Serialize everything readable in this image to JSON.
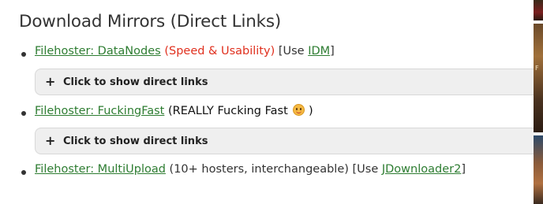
{
  "heading": "Download Mirrors (Direct Links)",
  "mirrors": [
    {
      "host_link": "Filehoster: DataNodes",
      "note": "(Speed & Usability)",
      "bracket_open": " [Use ",
      "tool_link": "IDM",
      "bracket_close": "]",
      "toggle_label": "Click to show direct links"
    },
    {
      "host_link": "Filehoster: FuckingFast",
      "note": " (REALLY Fucking Fast ",
      "emoji": "smiley-face-icon",
      "note_close": " )",
      "toggle_label": "Click to show direct links"
    },
    {
      "host_link": "Filehoster: MultiUpload",
      "note": " (10+ hosters, interchangeable) [Use ",
      "tool_link": "JDownloader2",
      "bracket_close": "]"
    }
  ],
  "colors": {
    "link": "#2e7d32",
    "highlight": "#e0301e",
    "toggle_bg": "#efefef",
    "text": "#333333"
  }
}
